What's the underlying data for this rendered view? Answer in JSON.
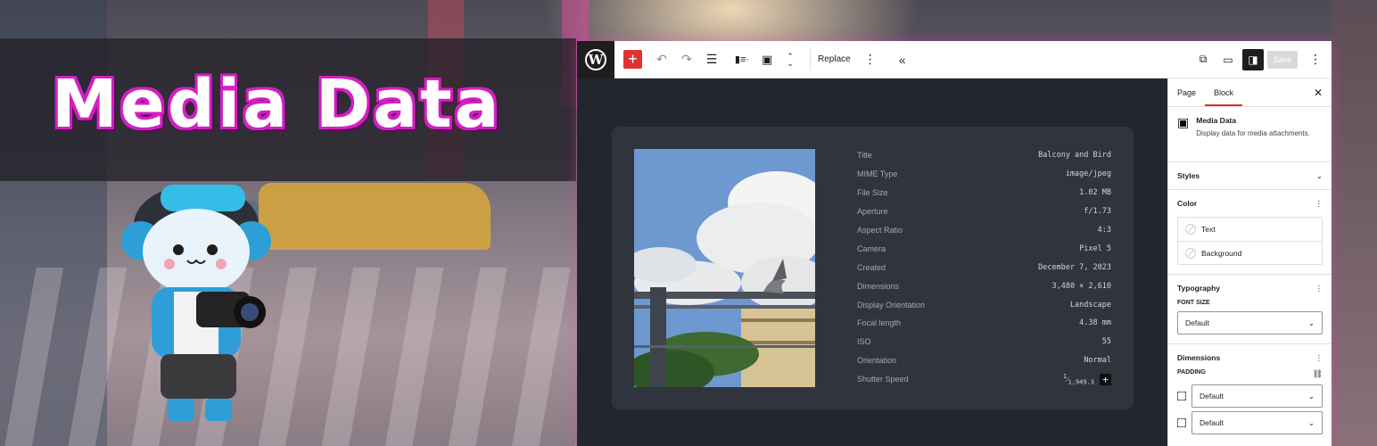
{
  "hero": {
    "title": "Media Data"
  },
  "toolbar": {
    "add_icon": "plus-icon",
    "replace_label": "Replace",
    "save_label": "Save"
  },
  "block": {
    "metadata": [
      {
        "key": "Title",
        "value": "Balcony and Bird"
      },
      {
        "key": "MIME Type",
        "value": "image/jpeg"
      },
      {
        "key": "File Size",
        "value": "1.02 MB"
      },
      {
        "key": "Aperture",
        "value": "f/1.73"
      },
      {
        "key": "Aspect Ratio",
        "value": "4:3"
      },
      {
        "key": "Camera",
        "value": "Pixel 5"
      },
      {
        "key": "Created",
        "value": "December 7, 2023"
      },
      {
        "key": "Dimensions",
        "value": "3,480 × 2,610"
      },
      {
        "key": "Display Orientation",
        "value": "Landscape"
      },
      {
        "key": "Focal length",
        "value": "4.38 mm"
      },
      {
        "key": "ISO",
        "value": "55"
      },
      {
        "key": "Orientation",
        "value": "Normal"
      },
      {
        "key": "Shutter Speed",
        "value_sup": "1",
        "value_sub": "1,949.3"
      }
    ]
  },
  "sidebar": {
    "tabs": [
      "Page",
      "Block"
    ],
    "block_title": "Media Data",
    "block_desc": "Display data for media attachments.",
    "styles_label": "Styles",
    "color_label": "Color",
    "color_items": [
      "Text",
      "Background"
    ],
    "typography_label": "Typography",
    "font_size_label": "FONT SIZE",
    "font_size_value": "Default",
    "dimensions_label": "Dimensions",
    "padding_label": "PADDING",
    "padding_values": [
      "Default",
      "Default"
    ]
  }
}
